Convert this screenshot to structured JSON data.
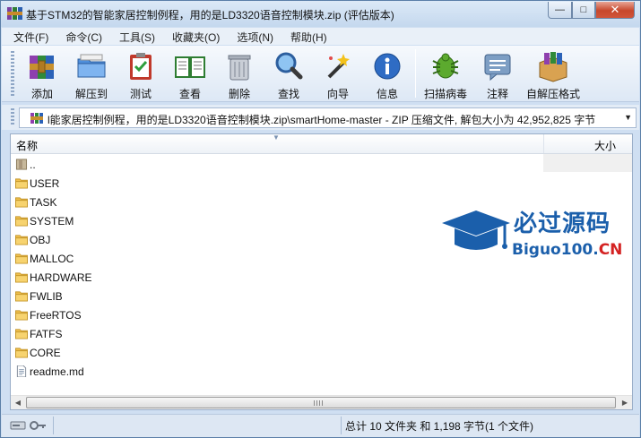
{
  "window": {
    "title": "基于STM32的智能家居控制例程，用的是LD3320语音控制模块.zip (评估版本)",
    "controls": {
      "minimize": "—",
      "maximize": "□",
      "close": "✕"
    }
  },
  "menu": [
    {
      "label": "文件(F)"
    },
    {
      "label": "命令(C)"
    },
    {
      "label": "工具(S)"
    },
    {
      "label": "收藏夹(O)"
    },
    {
      "label": "选项(N)"
    },
    {
      "label": "帮助(H)"
    }
  ],
  "toolbar": [
    {
      "label": "添加",
      "icon": "add-books-icon"
    },
    {
      "label": "解压到",
      "icon": "extract-folder-icon"
    },
    {
      "label": "测试",
      "icon": "test-clipboard-icon"
    },
    {
      "label": "查看",
      "icon": "view-book-icon"
    },
    {
      "label": "删除",
      "icon": "trash-icon"
    },
    {
      "label": "查找",
      "icon": "magnifier-icon"
    },
    {
      "label": "向导",
      "icon": "wizard-wand-icon"
    },
    {
      "label": "信息",
      "icon": "info-icon"
    },
    {
      "label": "扫描病毒",
      "icon": "virus-scan-icon"
    },
    {
      "label": "注释",
      "icon": "comment-icon"
    },
    {
      "label": "自解压格式",
      "icon": "sfx-box-icon"
    }
  ],
  "address": {
    "path": "l能家居控制例程，用的是LD3320语音控制模块.zip\\smartHome-master - ZIP 压缩文件, 解包大小为 42,952,825 字节"
  },
  "list": {
    "columns": {
      "name": "名称",
      "size": "大小"
    },
    "rows": [
      {
        "name": "..",
        "type": "parent"
      },
      {
        "name": "USER",
        "type": "folder"
      },
      {
        "name": "TASK",
        "type": "folder"
      },
      {
        "name": "SYSTEM",
        "type": "folder"
      },
      {
        "name": "OBJ",
        "type": "folder"
      },
      {
        "name": "MALLOC",
        "type": "folder"
      },
      {
        "name": "HARDWARE",
        "type": "folder"
      },
      {
        "name": "FWLIB",
        "type": "folder"
      },
      {
        "name": "FreeRTOS",
        "type": "folder"
      },
      {
        "name": "FATFS",
        "type": "folder"
      },
      {
        "name": "CORE",
        "type": "folder"
      },
      {
        "name": "readme.md",
        "type": "file"
      }
    ]
  },
  "watermark": {
    "title": "必过源码",
    "site_main": "Biguo100.",
    "site_cn": "CN"
  },
  "status": {
    "summary": "总计 10 文件夹 和 1,198 字节(1 个文件)"
  },
  "colors": {
    "window_bg": "#cfdff2",
    "folder": "#f2c14e",
    "watermark": "#1b5fab",
    "accent_red": "#d42222"
  }
}
